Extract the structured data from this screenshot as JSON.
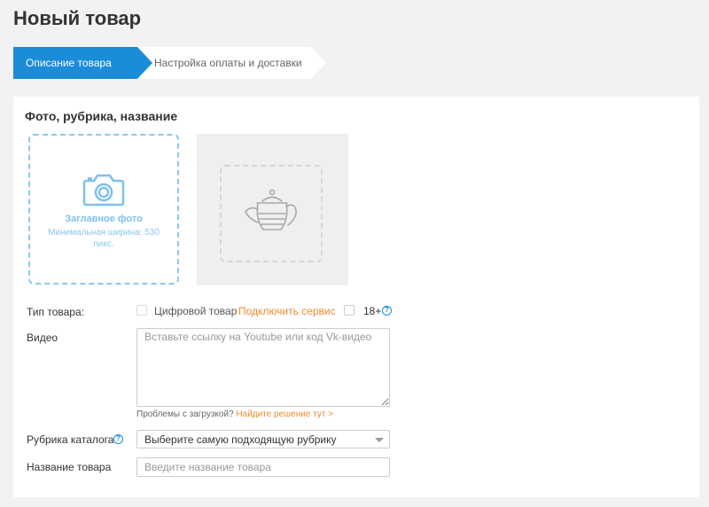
{
  "page": {
    "title": "Новый товар"
  },
  "steps": [
    {
      "label": "Описание товара",
      "active": true
    },
    {
      "label": "Настройка оплаты и доставки",
      "active": false
    }
  ],
  "section": {
    "title": "Фото, рубрика, название"
  },
  "photo": {
    "title": "Заглавное фото",
    "hint": "Минимальная ширина: 530 пикс.",
    "icon": "camera-icon",
    "placeholder_icon": "teapot-icon"
  },
  "product_type": {
    "label": "Тип товара:",
    "digital_label": "Цифровой товар",
    "connect_link": "Подключить сервис",
    "age_label": "18+",
    "help": "?"
  },
  "video": {
    "label": "Видео",
    "placeholder": "Вставьте ссылку на Youtube или код Vk-видео",
    "problem_text": "Проблемы с загрузкой?",
    "solution_link": "Найдите решение тут >"
  },
  "category": {
    "label": "Рубрика каталога",
    "help": "?",
    "selected": "Выберите самую подходящую рубрику"
  },
  "name_field": {
    "label": "Название товара",
    "placeholder": "Введите название товара"
  },
  "colors": {
    "accent": "#1b8cd8",
    "link_orange": "#f08c2e",
    "upload_border": "#8cc7ee"
  }
}
